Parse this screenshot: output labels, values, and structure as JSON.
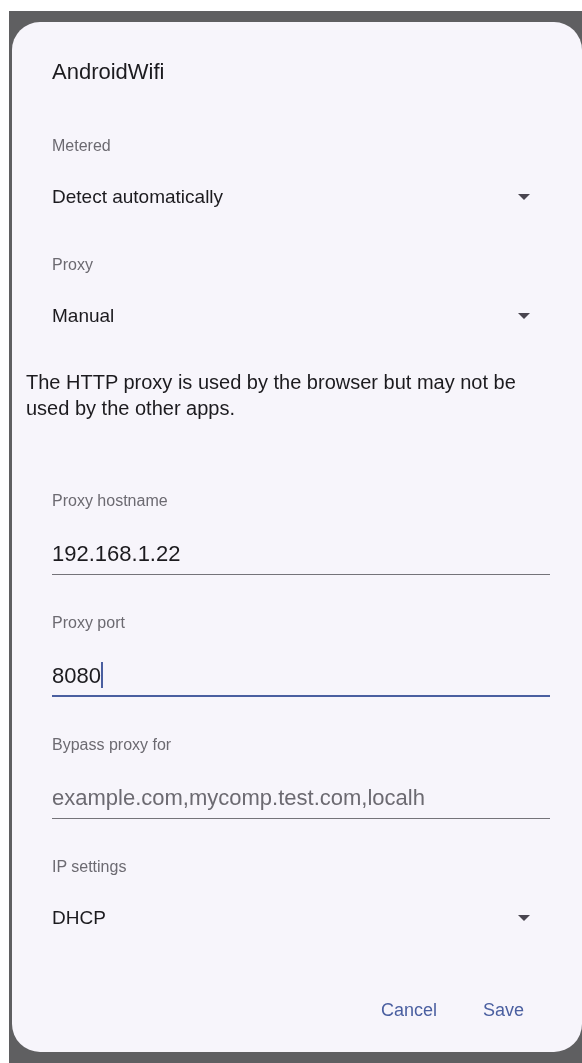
{
  "dialog": {
    "title": "AndroidWifi",
    "items": [
      {
        "kind": "dropdown",
        "label": "Metered",
        "value": "Detect automatically"
      },
      {
        "kind": "dropdown",
        "label": "Proxy",
        "value": "Manual"
      },
      {
        "kind": "note",
        "text": "The HTTP proxy is used by the browser but may not be used by the other apps."
      },
      {
        "kind": "text_field",
        "label": "Proxy hostname",
        "value": "192.168.1.22",
        "focused": false
      },
      {
        "kind": "text_field",
        "label": "Proxy port",
        "value": "8080",
        "focused": true
      },
      {
        "kind": "text_field",
        "label": "Bypass proxy for",
        "placeholder": "example.com,mycomp.test.com,localh",
        "focused": false
      },
      {
        "kind": "dropdown",
        "label": "IP settings",
        "value": "DHCP"
      }
    ],
    "buttons": [
      "Cancel",
      "Save"
    ]
  }
}
